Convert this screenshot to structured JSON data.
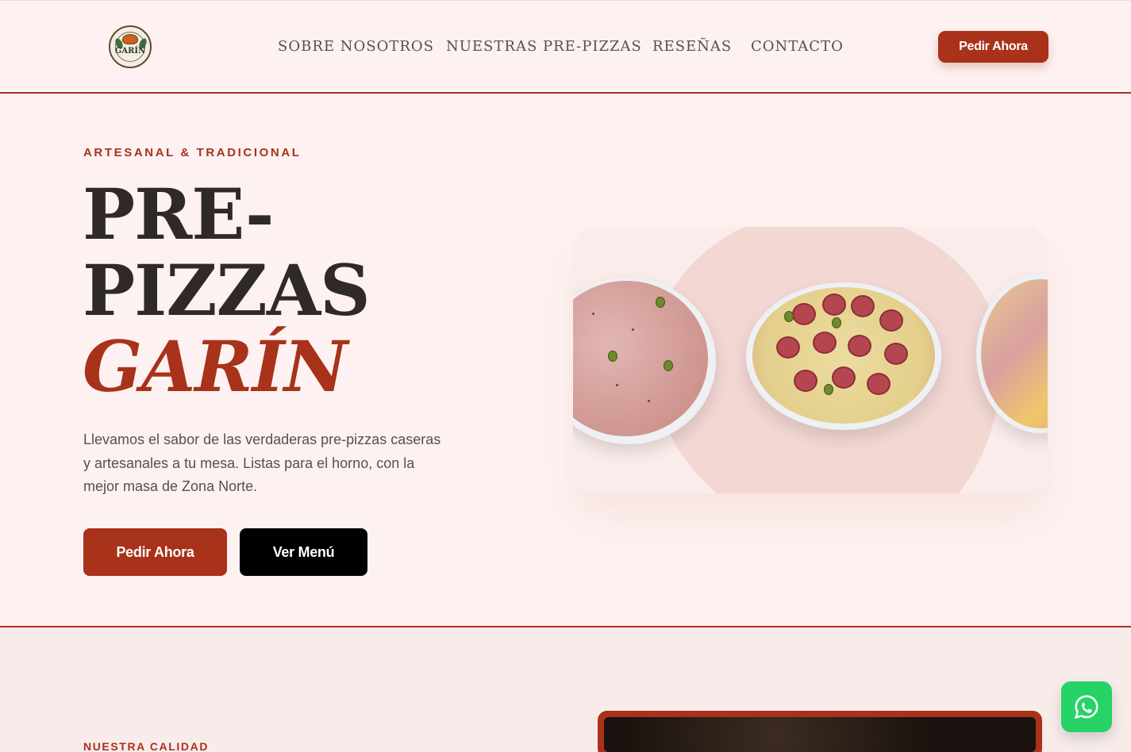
{
  "brand": {
    "logo_text": "GARÍN",
    "accent_color": "#a8321a"
  },
  "nav": {
    "items": [
      {
        "label": "SOBRE NOSOTROS"
      },
      {
        "label": "NUESTRAS PRE-PIZZAS"
      },
      {
        "label": "RESEÑAS"
      },
      {
        "label": "CONTACTO"
      }
    ],
    "cta_label": "Pedir Ahora"
  },
  "hero": {
    "eyebrow": "ARTESANAL & TRADICIONAL",
    "title_line1": "PRE-",
    "title_line2": "PIZZAS",
    "title_line3": "GARÍN",
    "lead": "Llevamos el sabor de las verdaderas pre-pizzas caseras y artesanales a tu mesa. Listas para el horno, con la mejor masa de Zona Norte.",
    "primary_button": "Pedir Ahora",
    "secondary_button": "Ver Menú"
  },
  "quality": {
    "eyebrow": "NUESTRA CALIDAD"
  },
  "whatsapp": {
    "icon": "whatsapp-icon",
    "color": "#25d366"
  }
}
